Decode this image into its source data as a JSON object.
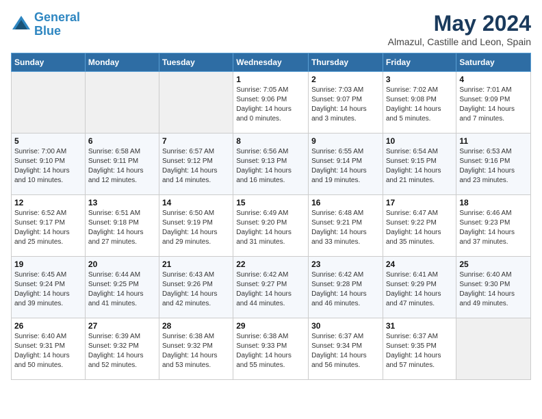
{
  "header": {
    "logo_line1": "General",
    "logo_line2": "Blue",
    "month_title": "May 2024",
    "subtitle": "Almazul, Castille and Leon, Spain"
  },
  "days_of_week": [
    "Sunday",
    "Monday",
    "Tuesday",
    "Wednesday",
    "Thursday",
    "Friday",
    "Saturday"
  ],
  "weeks": [
    [
      {
        "day": "",
        "info": ""
      },
      {
        "day": "",
        "info": ""
      },
      {
        "day": "",
        "info": ""
      },
      {
        "day": "1",
        "info": "Sunrise: 7:05 AM\nSunset: 9:06 PM\nDaylight: 14 hours\nand 0 minutes."
      },
      {
        "day": "2",
        "info": "Sunrise: 7:03 AM\nSunset: 9:07 PM\nDaylight: 14 hours\nand 3 minutes."
      },
      {
        "day": "3",
        "info": "Sunrise: 7:02 AM\nSunset: 9:08 PM\nDaylight: 14 hours\nand 5 minutes."
      },
      {
        "day": "4",
        "info": "Sunrise: 7:01 AM\nSunset: 9:09 PM\nDaylight: 14 hours\nand 7 minutes."
      }
    ],
    [
      {
        "day": "5",
        "info": "Sunrise: 7:00 AM\nSunset: 9:10 PM\nDaylight: 14 hours\nand 10 minutes."
      },
      {
        "day": "6",
        "info": "Sunrise: 6:58 AM\nSunset: 9:11 PM\nDaylight: 14 hours\nand 12 minutes."
      },
      {
        "day": "7",
        "info": "Sunrise: 6:57 AM\nSunset: 9:12 PM\nDaylight: 14 hours\nand 14 minutes."
      },
      {
        "day": "8",
        "info": "Sunrise: 6:56 AM\nSunset: 9:13 PM\nDaylight: 14 hours\nand 16 minutes."
      },
      {
        "day": "9",
        "info": "Sunrise: 6:55 AM\nSunset: 9:14 PM\nDaylight: 14 hours\nand 19 minutes."
      },
      {
        "day": "10",
        "info": "Sunrise: 6:54 AM\nSunset: 9:15 PM\nDaylight: 14 hours\nand 21 minutes."
      },
      {
        "day": "11",
        "info": "Sunrise: 6:53 AM\nSunset: 9:16 PM\nDaylight: 14 hours\nand 23 minutes."
      }
    ],
    [
      {
        "day": "12",
        "info": "Sunrise: 6:52 AM\nSunset: 9:17 PM\nDaylight: 14 hours\nand 25 minutes."
      },
      {
        "day": "13",
        "info": "Sunrise: 6:51 AM\nSunset: 9:18 PM\nDaylight: 14 hours\nand 27 minutes."
      },
      {
        "day": "14",
        "info": "Sunrise: 6:50 AM\nSunset: 9:19 PM\nDaylight: 14 hours\nand 29 minutes."
      },
      {
        "day": "15",
        "info": "Sunrise: 6:49 AM\nSunset: 9:20 PM\nDaylight: 14 hours\nand 31 minutes."
      },
      {
        "day": "16",
        "info": "Sunrise: 6:48 AM\nSunset: 9:21 PM\nDaylight: 14 hours\nand 33 minutes."
      },
      {
        "day": "17",
        "info": "Sunrise: 6:47 AM\nSunset: 9:22 PM\nDaylight: 14 hours\nand 35 minutes."
      },
      {
        "day": "18",
        "info": "Sunrise: 6:46 AM\nSunset: 9:23 PM\nDaylight: 14 hours\nand 37 minutes."
      }
    ],
    [
      {
        "day": "19",
        "info": "Sunrise: 6:45 AM\nSunset: 9:24 PM\nDaylight: 14 hours\nand 39 minutes."
      },
      {
        "day": "20",
        "info": "Sunrise: 6:44 AM\nSunset: 9:25 PM\nDaylight: 14 hours\nand 41 minutes."
      },
      {
        "day": "21",
        "info": "Sunrise: 6:43 AM\nSunset: 9:26 PM\nDaylight: 14 hours\nand 42 minutes."
      },
      {
        "day": "22",
        "info": "Sunrise: 6:42 AM\nSunset: 9:27 PM\nDaylight: 14 hours\nand 44 minutes."
      },
      {
        "day": "23",
        "info": "Sunrise: 6:42 AM\nSunset: 9:28 PM\nDaylight: 14 hours\nand 46 minutes."
      },
      {
        "day": "24",
        "info": "Sunrise: 6:41 AM\nSunset: 9:29 PM\nDaylight: 14 hours\nand 47 minutes."
      },
      {
        "day": "25",
        "info": "Sunrise: 6:40 AM\nSunset: 9:30 PM\nDaylight: 14 hours\nand 49 minutes."
      }
    ],
    [
      {
        "day": "26",
        "info": "Sunrise: 6:40 AM\nSunset: 9:31 PM\nDaylight: 14 hours\nand 50 minutes."
      },
      {
        "day": "27",
        "info": "Sunrise: 6:39 AM\nSunset: 9:32 PM\nDaylight: 14 hours\nand 52 minutes."
      },
      {
        "day": "28",
        "info": "Sunrise: 6:38 AM\nSunset: 9:32 PM\nDaylight: 14 hours\nand 53 minutes."
      },
      {
        "day": "29",
        "info": "Sunrise: 6:38 AM\nSunset: 9:33 PM\nDaylight: 14 hours\nand 55 minutes."
      },
      {
        "day": "30",
        "info": "Sunrise: 6:37 AM\nSunset: 9:34 PM\nDaylight: 14 hours\nand 56 minutes."
      },
      {
        "day": "31",
        "info": "Sunrise: 6:37 AM\nSunset: 9:35 PM\nDaylight: 14 hours\nand 57 minutes."
      },
      {
        "day": "",
        "info": ""
      }
    ]
  ]
}
